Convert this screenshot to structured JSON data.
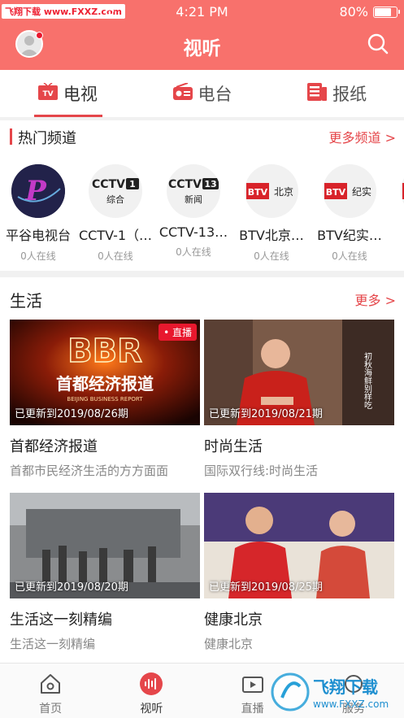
{
  "status": {
    "time": "4:21 PM",
    "battery_pct": "80%",
    "battery_level": 0.8,
    "watermark_badge": "飞翔下载 www.FXXZ.com"
  },
  "header": {
    "title": "视听"
  },
  "tabs": [
    {
      "label": "电视",
      "icon": "tv-icon",
      "active": true
    },
    {
      "label": "电台",
      "icon": "radio-icon",
      "active": false
    },
    {
      "label": "报纸",
      "icon": "newspaper-icon",
      "active": false
    }
  ],
  "hot": {
    "title": "热门频道",
    "more": "更多频道 >"
  },
  "channels": [
    {
      "name": "平谷电视台",
      "online": "0人在线",
      "logo": "pinggu-logo"
    },
    {
      "name": "CCTV-1（…",
      "online": "0人在线",
      "logo": "cctv1-logo",
      "logo_text": "CCTV",
      "logo_num": "1",
      "logo_sub": "综合"
    },
    {
      "name": "CCTV-13…",
      "online": "0人在线",
      "logo": "cctv13-logo",
      "logo_text": "CCTV",
      "logo_num": "13",
      "logo_sub": "新闻"
    },
    {
      "name": "BTV北京…",
      "online": "0人在线",
      "logo": "btv-beijing-logo",
      "logo_text": "BTV",
      "logo_sub": "北京"
    },
    {
      "name": "BTV纪实…",
      "online": "0人在线",
      "logo": "btv-jishi-logo",
      "logo_text": "BTV",
      "logo_sub": "纪实"
    },
    {
      "name": "B",
      "online": "",
      "logo": "partial-logo"
    }
  ],
  "life": {
    "title": "生活",
    "more": "更多 >",
    "cards": [
      {
        "title": "首都经济报道",
        "sub": "首都市民经济生活的方方面面",
        "updated": "已更新到2019/08/26期",
        "live": "• 直播",
        "thumb_title": "首都经济报道",
        "thumb_logo": "BBR",
        "thumb_en": "BEIJING BUSINESS REPORT"
      },
      {
        "title": "时尚生活",
        "sub": "国际双行线:时尚生活",
        "updated": "已更新到2019/08/21期",
        "live": "",
        "thumb_side": "初秋海鲜别样吃"
      },
      {
        "title": "生活这一刻精编",
        "sub": "生活这一刻精编",
        "updated": "已更新到2019/08/20期",
        "live": ""
      },
      {
        "title": "健康北京",
        "sub": "健康北京",
        "updated": "已更新到2019/08/25期",
        "live": ""
      }
    ]
  },
  "bottom_nav": [
    {
      "label": "首页",
      "icon": "home-icon",
      "active": false
    },
    {
      "label": "视听",
      "icon": "audio-wave-icon",
      "active": true
    },
    {
      "label": "直播",
      "icon": "live-video-icon",
      "active": false
    },
    {
      "label": "服务",
      "icon": "service-icon",
      "active": false
    }
  ],
  "watermark": {
    "cn": "飞翔下载",
    "url": "www.FXXZ.com"
  },
  "colors": {
    "header_bg": "#f8716c",
    "accent": "#e5464a",
    "live_red": "#e8182e"
  }
}
